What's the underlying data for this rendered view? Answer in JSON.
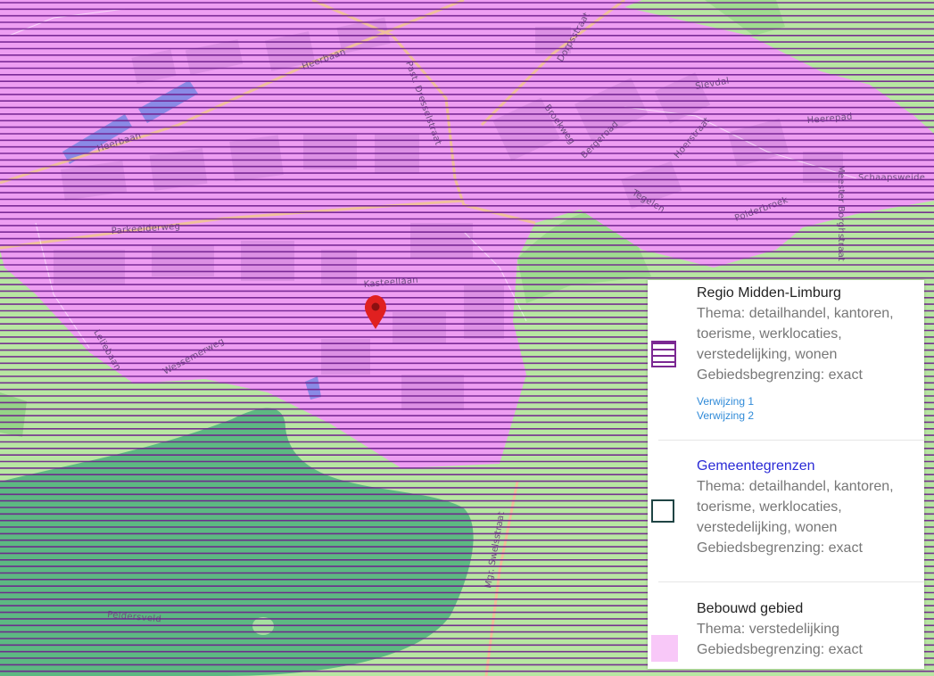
{
  "map": {
    "colors": {
      "green_area": "#b8e6a2",
      "built_area": "#ee9ef2",
      "forest": "#5db882",
      "stripe": "#6e1f8d",
      "marker": "#e02020",
      "road": "#f0c09c"
    },
    "marker_icon": "map-pin-icon",
    "streets": [
      "Heerbaan",
      "Heerbaan",
      "Past. Dresselstraat",
      "Dorpsstraat",
      "Parkeelderweg",
      "Kasteellaan",
      "Wessemerweg",
      "Leliebaan",
      "Broekweg",
      "Bergeroad",
      "Hoerstraat",
      "Slevdal",
      "Heerepad",
      "Schaapsweide",
      "Tegelen",
      "Polderbroek",
      "Meester Borghstraat",
      "Mgr. Swelsstraat",
      "Peldersveld"
    ]
  },
  "legend": {
    "items": [
      {
        "title": "Regio Midden-Limburg",
        "lines": [
          "Thema: detailhandel, kantoren,",
          "toerisme, werklocaties,",
          "verstedelijking, wonen",
          "Gebiedsbegrenzing: exact"
        ],
        "refs": [
          "Verwijzing 1",
          "Verwijzing 2"
        ],
        "symbol": "striped-area-icon"
      },
      {
        "title": "Gemeentegrenzen",
        "lines": [
          "Thema: detailhandel, kantoren,",
          "toerisme, werklocaties,",
          "verstedelijking, wonen",
          "Gebiedsbegrenzing: exact"
        ],
        "symbol": "outline-area-icon"
      },
      {
        "title": "Bebouwd gebied",
        "lines": [
          "Thema: verstedelijking",
          "Gebiedsbegrenzing: exact"
        ],
        "symbol": "filled-area-icon"
      }
    ]
  }
}
